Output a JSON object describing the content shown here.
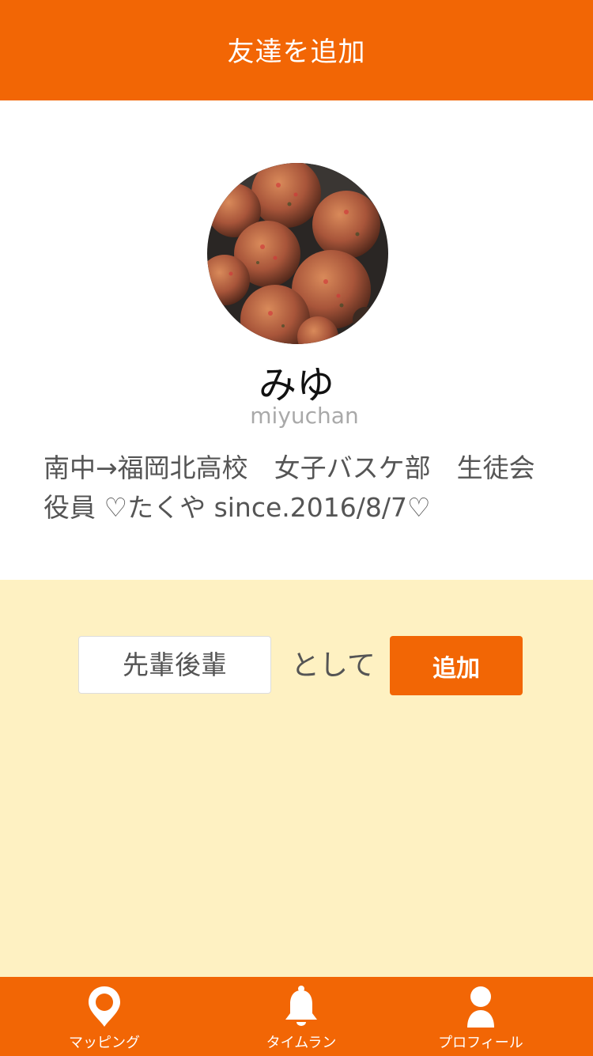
{
  "header": {
    "title": "友達を追加"
  },
  "profile": {
    "display_name": "みゆ",
    "username": "miyuchan",
    "bio": "南中→福岡北高校　女子バスケ部　生徒会役員 ♡たくや since.2016/8/7♡"
  },
  "add_form": {
    "relation_selected": "先輩後輩",
    "as_label": "として",
    "add_button_label": "追加"
  },
  "tabbar": {
    "tabs": [
      {
        "label": "マッピング",
        "icon": "map-pin-icon"
      },
      {
        "label": "タイムラン",
        "icon": "bell-icon"
      },
      {
        "label": "プロフィール",
        "icon": "user-icon"
      }
    ]
  },
  "colors": {
    "accent": "#F26605",
    "panel_background": "#FEF1C2",
    "text_gray": "#555555",
    "username_gray": "#A9A9A9"
  }
}
